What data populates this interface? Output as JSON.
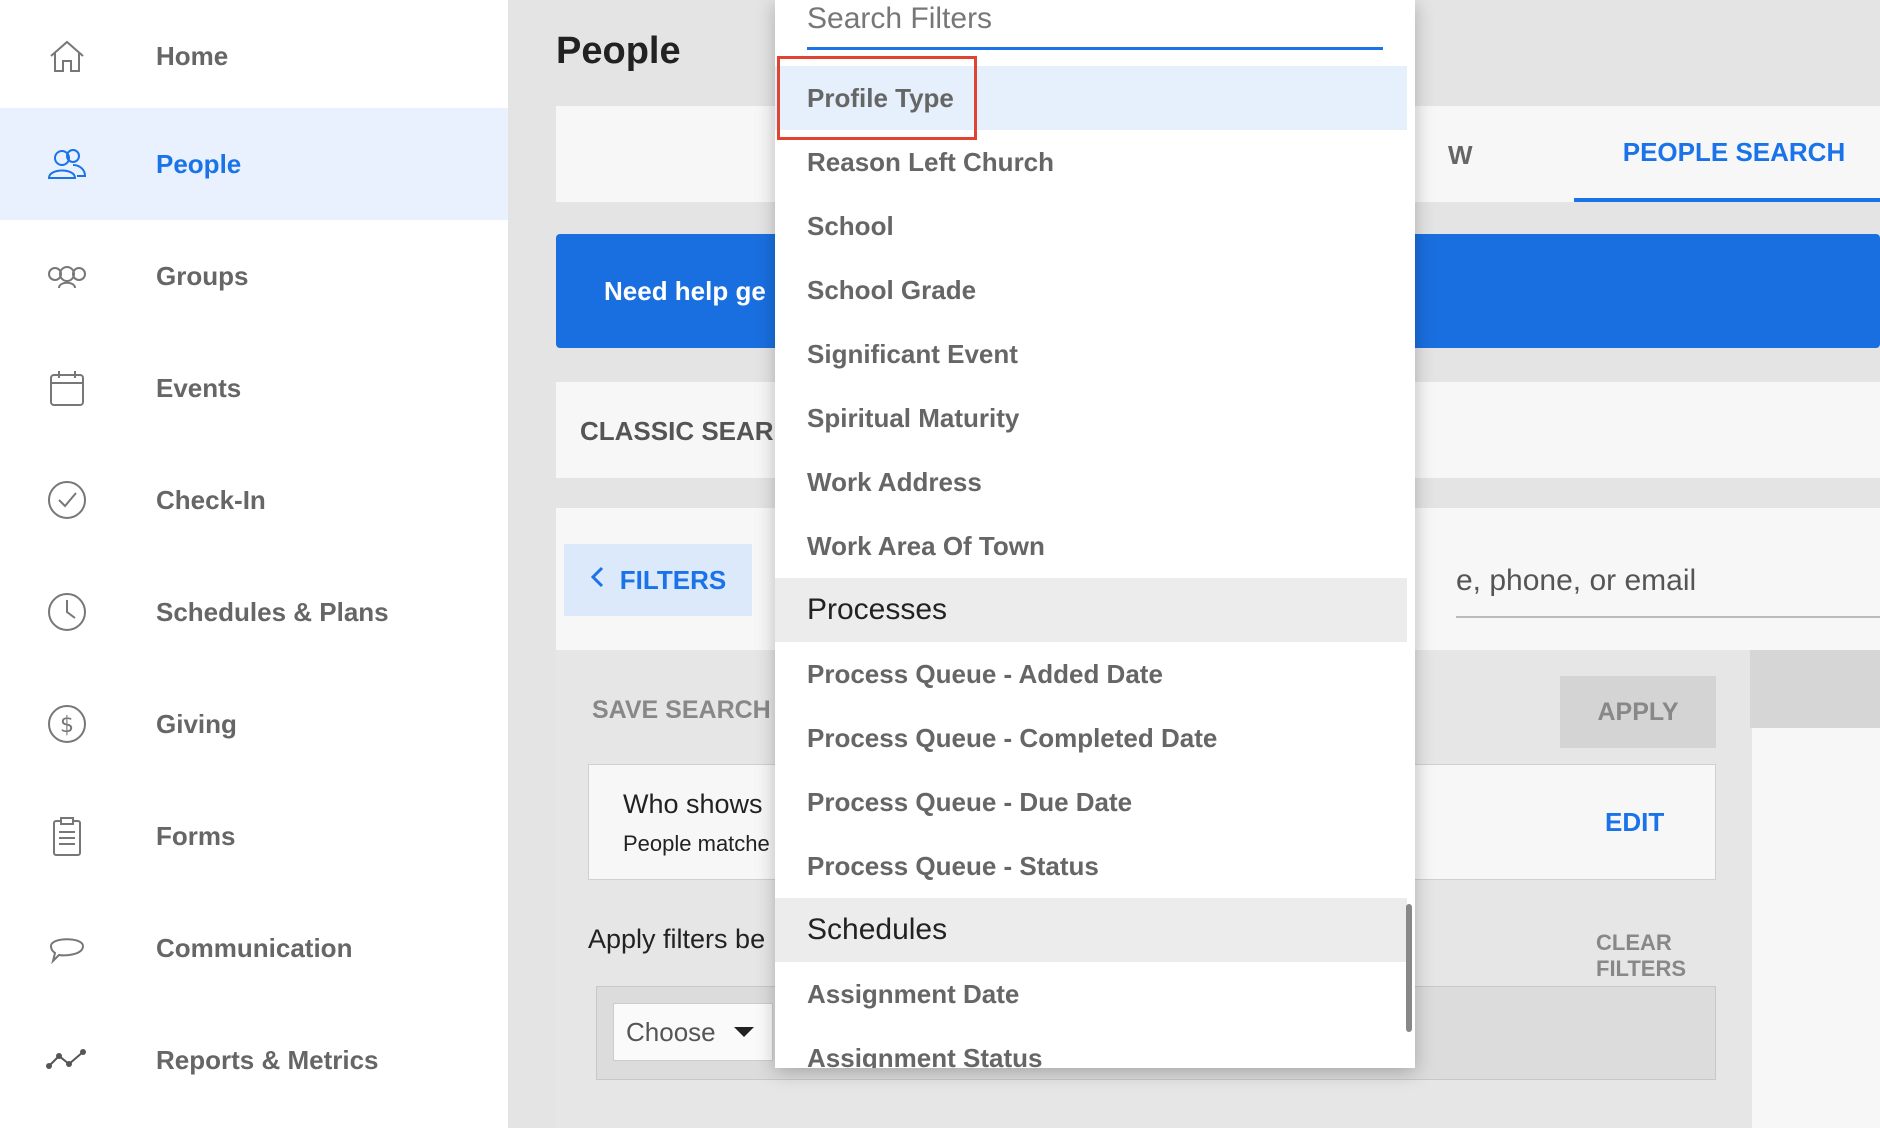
{
  "sidebar": {
    "items": [
      {
        "label": "Home",
        "icon": "home-icon"
      },
      {
        "label": "People",
        "icon": "people-icon",
        "active": true
      },
      {
        "label": "Groups",
        "icon": "groups-icon"
      },
      {
        "label": "Events",
        "icon": "calendar-icon"
      },
      {
        "label": "Check-In",
        "icon": "check-circle-icon"
      },
      {
        "label": "Schedules & Plans",
        "icon": "clock-icon"
      },
      {
        "label": "Giving",
        "icon": "dollar-icon"
      },
      {
        "label": "Forms",
        "icon": "clipboard-icon"
      },
      {
        "label": "Communication",
        "icon": "chat-icon"
      },
      {
        "label": "Reports & Metrics",
        "icon": "metrics-icon"
      }
    ]
  },
  "main": {
    "title": "People",
    "tabs": {
      "partial_tab": "W",
      "people_search": "PEOPLE SEARCH"
    },
    "help_banner": "Need help ge",
    "classic_search": "CLASSIC SEAR",
    "filters_button": "FILTERS",
    "search_input_visible": "e, phone, or email",
    "save_search": "SAVE SEARCH",
    "apply": "APPLY",
    "who_title": "Who shows",
    "who_subtitle": "People matche",
    "edit": "EDIT",
    "apply_filters_text": "Apply filters be",
    "clear_filters": "CLEAR FILTERS",
    "choose": "Choose"
  },
  "dropdown": {
    "search_placeholder": "Search Filters",
    "items": [
      {
        "label": "Profile Type",
        "type": "item",
        "selected": true
      },
      {
        "label": "Reason Left Church",
        "type": "item"
      },
      {
        "label": "School",
        "type": "item"
      },
      {
        "label": "School Grade",
        "type": "item"
      },
      {
        "label": "Significant Event",
        "type": "item"
      },
      {
        "label": "Spiritual Maturity",
        "type": "item"
      },
      {
        "label": "Work Address",
        "type": "item"
      },
      {
        "label": "Work Area Of Town",
        "type": "item"
      },
      {
        "label": "Processes",
        "type": "header"
      },
      {
        "label": "Process Queue - Added Date",
        "type": "item"
      },
      {
        "label": "Process Queue - Completed Date",
        "type": "item"
      },
      {
        "label": "Process Queue - Due Date",
        "type": "item"
      },
      {
        "label": "Process Queue - Status",
        "type": "item"
      },
      {
        "label": "Schedules",
        "type": "header"
      },
      {
        "label": "Assignment Date",
        "type": "item"
      },
      {
        "label": "Assignment Status",
        "type": "item"
      }
    ]
  },
  "colors": {
    "accent": "#1a73e8",
    "highlight_box": "#e0432f",
    "banner": "#1a6fe0"
  }
}
